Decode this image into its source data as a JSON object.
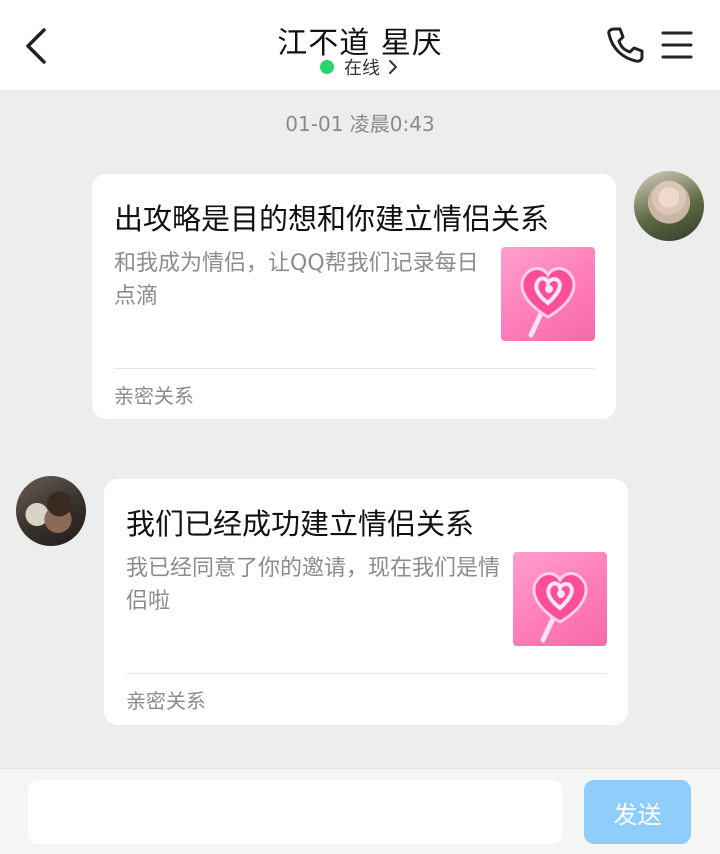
{
  "header": {
    "title": "江不道 星厌",
    "status_text": "在线",
    "status_color": "#2bd46b"
  },
  "icons": [
    "back-icon",
    "chevron-right-icon",
    "phone-icon",
    "menu-icon",
    "lollipop-icon"
  ],
  "chat": {
    "timestamp": "01-01 凌晨0:43",
    "messages": [
      {
        "side": "right",
        "title": "出攻略是目的想和你建立情侣关系",
        "description": "和我成为情侣，让QQ帮我们记录每日点滴",
        "footer": "亲密关系"
      },
      {
        "side": "left",
        "title": "我们已经成功建立情侣关系",
        "description": "我已经同意了你的邀请，现在我们是情侣啦",
        "footer": "亲密关系"
      }
    ]
  },
  "composer": {
    "input_value": "",
    "send_label": "发送",
    "send_color": "#8fcdfb"
  }
}
